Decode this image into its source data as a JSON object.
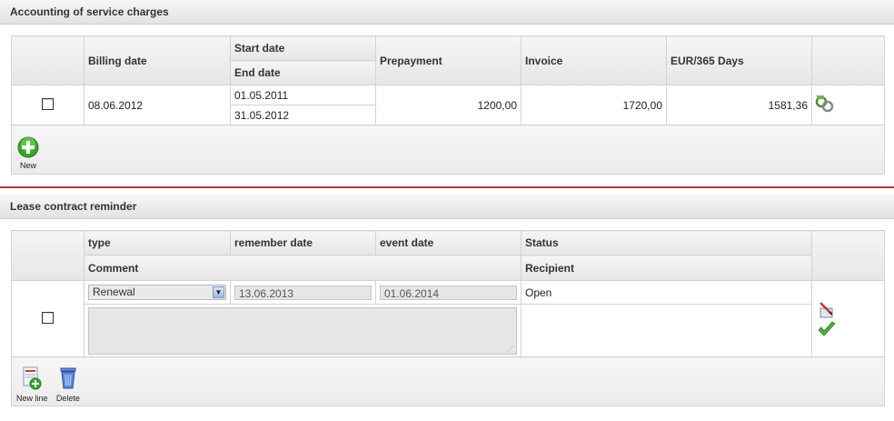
{
  "section1": {
    "title": "Accounting of service charges",
    "headers": {
      "billing_date": "Billing date",
      "start_date": "Start date",
      "end_date": "End date",
      "prepayment": "Prepayment",
      "invoice": "Invoice",
      "eur_365": "EUR/365 Days"
    },
    "row": {
      "billing_date": "08.06.2012",
      "start_date": "01.05.2011",
      "end_date": "31.05.2012",
      "prepayment": "1200,00",
      "invoice": "1720,00",
      "eur_365": "1581,36",
      "action_icon": "link-icon"
    },
    "toolbar": {
      "new_label": "New",
      "new_icon": "add-circle-icon"
    }
  },
  "section2": {
    "title": "Lease contract reminder",
    "headers": {
      "type": "type",
      "remember_date": "remember date",
      "event_date": "event date",
      "status": "Status",
      "comment": "Comment",
      "recipient": "Recipient"
    },
    "row": {
      "type_value": "Renewal",
      "remember_date": "13.06.2013",
      "event_date": "01.06.2014",
      "status": "Open",
      "comment": "",
      "recipient": ""
    },
    "toolbar": {
      "new_line_label": "New line",
      "delete_label": "Delete"
    }
  },
  "colors": {
    "divider": "#b33a3a",
    "accent_green": "#3a9a2a"
  }
}
